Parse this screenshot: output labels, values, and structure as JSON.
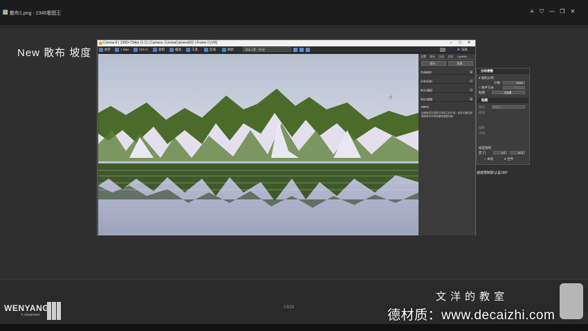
{
  "window": {
    "title": "散布1.png - 2345看图王",
    "controls": [
      "≡",
      "⛉",
      "—",
      "❐",
      "✕"
    ]
  },
  "slide": {
    "title": "New 散布 坡度",
    "note": "坡度限制默认是180°"
  },
  "corona": {
    "title": "Corona 8 | 1305×734px (1:1) | Camera: CoronaCamera002 | Frame 0 [VR]",
    "toolbar": [
      "保存",
      "+ Max",
      "Ctrl+C",
      "复制",
      "播放",
      "工具",
      "区域",
      "刷新"
    ],
    "select_value": "渲染元素（合成）",
    "render_button": "渲染",
    "tabs": [
      "设置",
      "统计",
      "历史",
      "日志",
      "LightMix"
    ],
    "buttons": [
      "保存...",
      "加载..."
    ],
    "rows": [
      "色调映射",
      "反射/折射",
      "辉光/耀斑",
      "锐化/模糊"
    ],
    "info_title": "INFO",
    "info_text": "此面板仅在渲染已完成之后可用。此处可通过调整参数实时修改最终图像效果。"
  },
  "scatter": {
    "header": "分布参数",
    "random_label": "随机分布",
    "count_label": "计数",
    "count_value": "30000",
    "per_area_label": "每平方米",
    "per_area_value": "10.0cm",
    "texture_label": "贴图",
    "texture_value": "无贴图",
    "section2": "贴图",
    "mode_label": "模式",
    "mode_value": "已映射",
    "threshold_label": "阈值",
    "offset_label": "偏移",
    "tile_label": "平铺",
    "limit_label": "坡度限制",
    "limit_unit": "度 [°]",
    "limit_min": "0.0",
    "limit_max": "60.0",
    "local_label": "本地",
    "world_label": "世界"
  },
  "footer": {
    "brand": "WENYANG",
    "brand_sub": "'s classroom",
    "page": "13/23",
    "classroom": "文洋的教室",
    "watermark": "德材质：www.decaizhi.com"
  }
}
